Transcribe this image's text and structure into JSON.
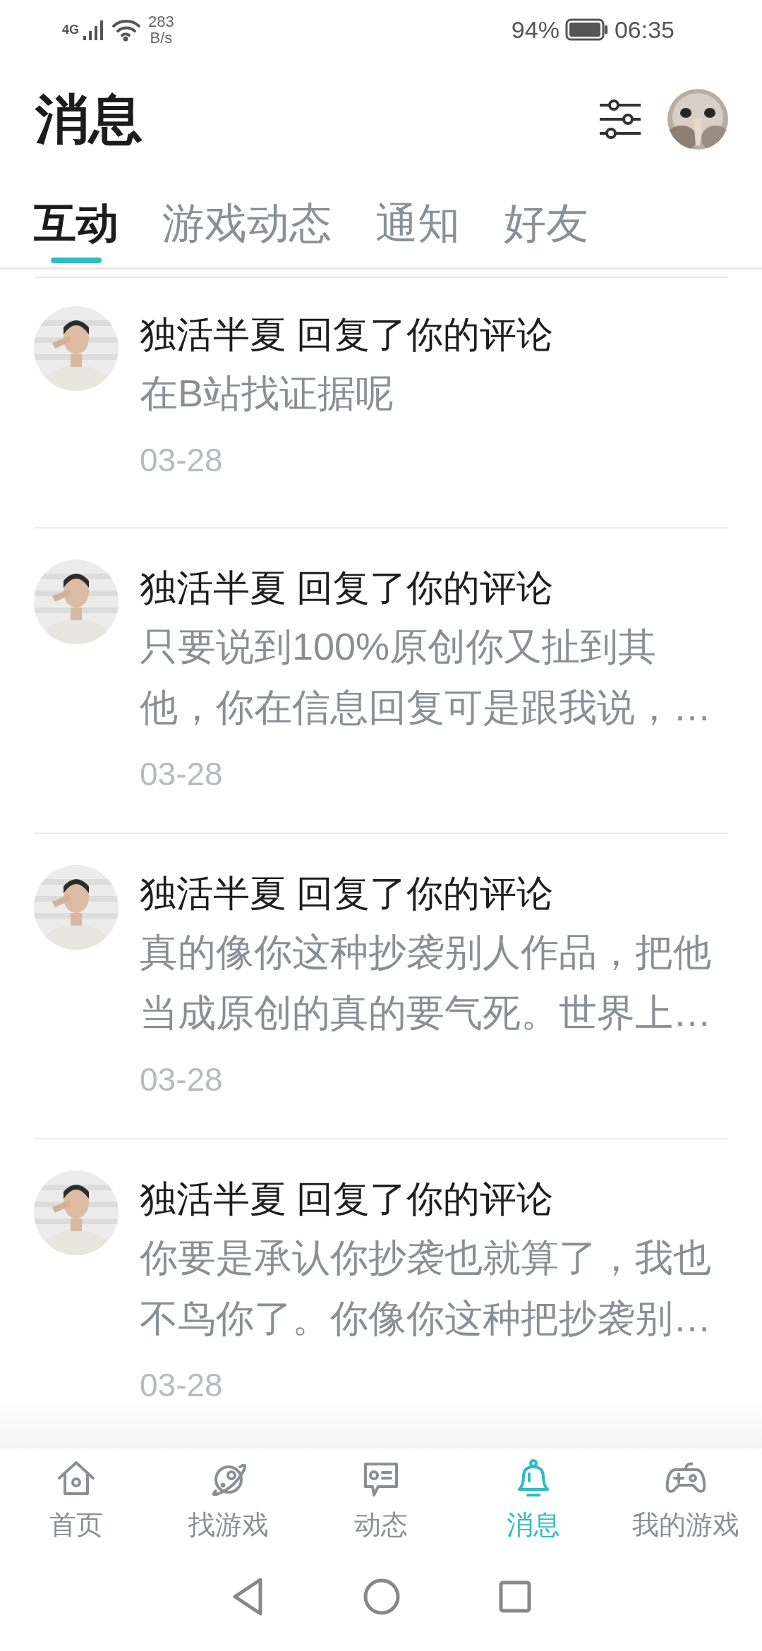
{
  "status_bar": {
    "network": "4G",
    "speed_value": "283",
    "speed_unit": "B/s",
    "battery": "94%",
    "time": "06:35"
  },
  "header": {
    "title": "消息"
  },
  "tabs": [
    {
      "label": "互动",
      "selected": true
    },
    {
      "label": "游戏动态",
      "selected": false
    },
    {
      "label": "通知",
      "selected": false
    },
    {
      "label": "好友",
      "selected": false
    }
  ],
  "messages": [
    {
      "title": "独活半夏 回复了你的评论",
      "text": "在B站找证据呢",
      "date": "03-28"
    },
    {
      "title": "独活半夏 回复了你的评论",
      "text": "只要说到100%原创你又扯到其他，你在信息回复可是跟我说，…",
      "date": "03-28"
    },
    {
      "title": "独活半夏 回复了你的评论",
      "text": "真的像你这种抄袭别人作品，把他当成原创的真的要气死。世界上…",
      "date": "03-28"
    },
    {
      "title": "独活半夏 回复了你的评论",
      "text": "你要是承认你抄袭也就算了，我也不鸟你了。你像你这种把抄袭别…",
      "date": "03-28"
    }
  ],
  "bottom_nav": [
    {
      "label": "首页",
      "kind": "home",
      "selected": false
    },
    {
      "label": "找游戏",
      "kind": "planet",
      "selected": false
    },
    {
      "label": "动态",
      "kind": "feed",
      "selected": false
    },
    {
      "label": "消息",
      "kind": "bell",
      "selected": true
    },
    {
      "label": "我的游戏",
      "kind": "gamepad",
      "selected": false
    }
  ]
}
